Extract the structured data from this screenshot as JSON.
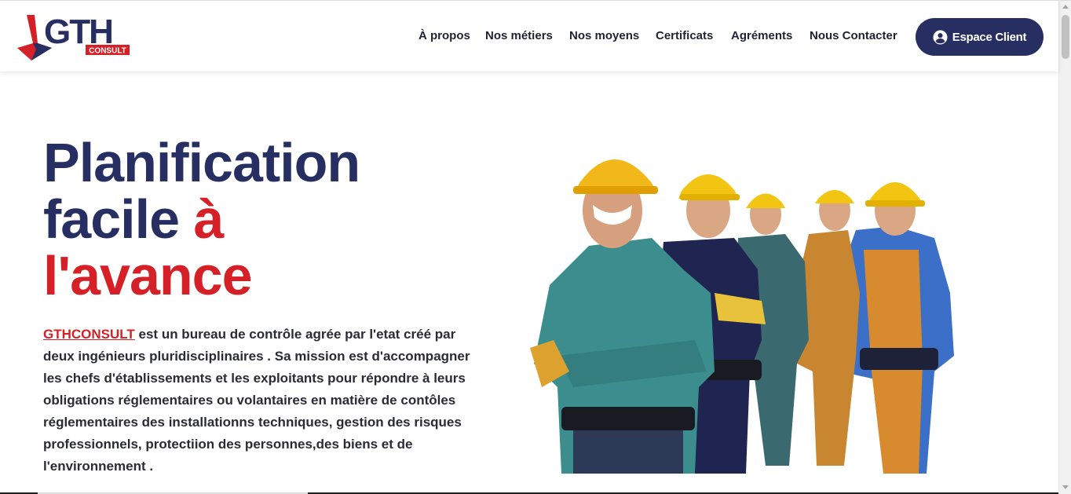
{
  "brand": {
    "logo_text": "GTH",
    "logo_sub": "CONSULT",
    "colors": {
      "navy": "#262e62",
      "red": "#d42026"
    }
  },
  "nav": {
    "items": [
      {
        "label": "À propos"
      },
      {
        "label": "Nos métiers"
      },
      {
        "label": "Nos moyens"
      },
      {
        "label": "Certificats"
      },
      {
        "label": "Agréments"
      },
      {
        "label": "Nous Contacter"
      }
    ],
    "cta_label": "Espace Client",
    "cta_icon": "user-circle-icon"
  },
  "hero": {
    "line1": "Planification",
    "line2_a": "facile",
    "line2_b": "à",
    "line3": "l'avance",
    "link_text": "GTHCONSULT",
    "body": " est un bureau de contrôle agrée par l'etat créé par deux ingénieurs pluridisciplinaires . Sa mission est d'accompagner les chefs d'établissements et les exploitants pour répondre à leurs obligations réglementaires ou volantaires en matière de contôles réglementaires des installationns techniques, gestion des risques professionnels, protectiion des personnes,des biens et de l'environnement ."
  },
  "illustration": {
    "subject": "group-of-construction-workers"
  }
}
